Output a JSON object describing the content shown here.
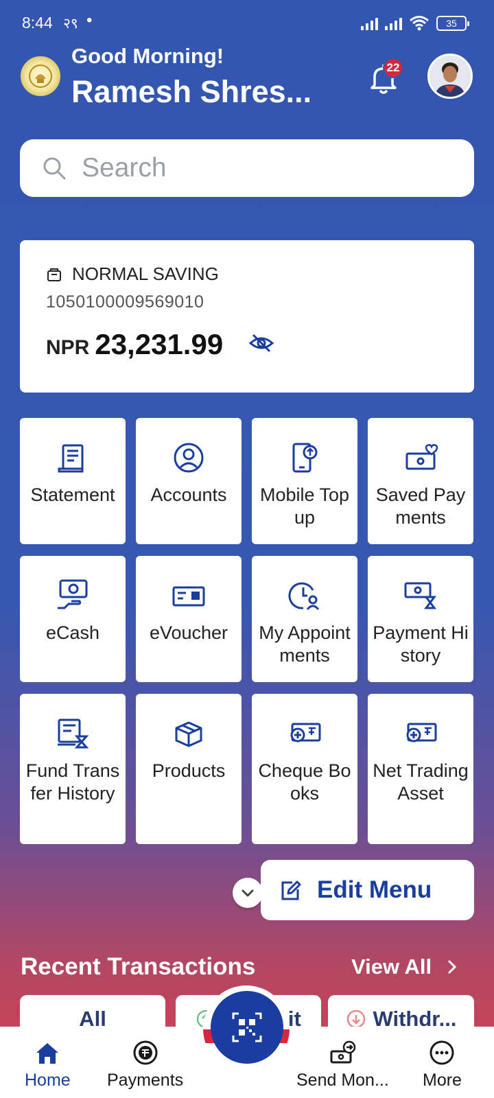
{
  "status_bar": {
    "time": "8:44",
    "extra": "२९",
    "dot": "•",
    "battery": "35"
  },
  "header": {
    "greeting": "Good Morning!",
    "username": "Ramesh Shres...",
    "notification_count": "22"
  },
  "search": {
    "placeholder": "Search"
  },
  "account": {
    "type": "NORMAL SAVING",
    "number": "1050100009569010",
    "currency": "NPR",
    "balance": "23,231.99"
  },
  "menu": {
    "items": [
      {
        "label": "Statement",
        "icon": "statement-icon"
      },
      {
        "label": "Accounts",
        "icon": "accounts-icon"
      },
      {
        "label": "Mobile Topup",
        "icon": "mobile-topup-icon"
      },
      {
        "label": "Saved Payments",
        "icon": "saved-payments-icon"
      },
      {
        "label": "eCash",
        "icon": "ecash-icon"
      },
      {
        "label": "eVoucher",
        "icon": "evoucher-icon"
      },
      {
        "label": "My Appointments",
        "icon": "appointments-icon"
      },
      {
        "label": "Payment History",
        "icon": "payment-history-icon"
      },
      {
        "label": "Fund Transfer History",
        "icon": "fund-transfer-history-icon"
      },
      {
        "label": "Products",
        "icon": "products-icon"
      },
      {
        "label": "Cheque Books",
        "icon": "cheque-books-icon"
      },
      {
        "label": "Net Trading Asset",
        "icon": "net-trading-asset-icon"
      }
    ],
    "edit_label": "Edit Menu"
  },
  "recent": {
    "title": "Recent Transactions",
    "view_all": "View All",
    "filters": [
      "All",
      "Deposit",
      "Withdr..."
    ]
  },
  "bottom_nav": {
    "items": [
      "Home",
      "Payments",
      "Send Mon...",
      "More"
    ]
  },
  "colors": {
    "primary": "#1a3ea0",
    "background_top": "#3356b0",
    "background_bottom": "#d9404f",
    "badge": "#d7263d"
  }
}
